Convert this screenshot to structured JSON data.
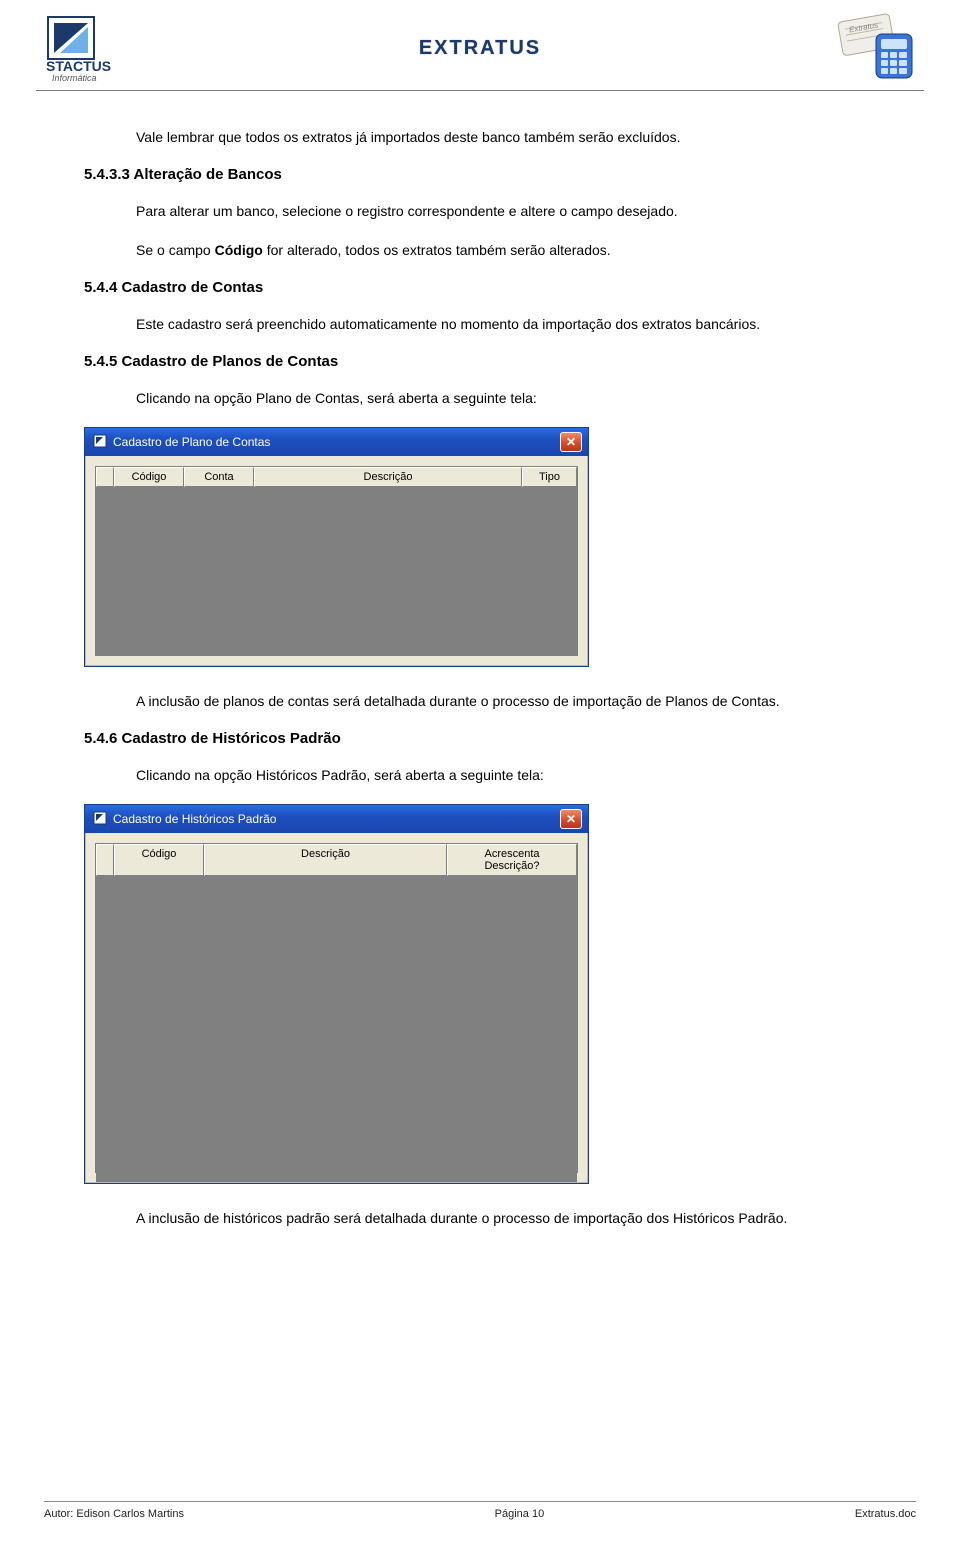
{
  "header": {
    "title": "EXTRATUS"
  },
  "paragraphs": {
    "intro": "Vale lembrar que todos os extratos já importados deste banco também serão excluídos.",
    "s533_title": "5.4.3.3  Alteração de Bancos",
    "s533_p1": "Para alterar um banco, selecione o registro correspondente e altere o campo desejado.",
    "s533_p2a": "Se o campo ",
    "s533_p2b": "Código",
    "s533_p2c": " for alterado, todos os extratos também serão alterados.",
    "s544_title": "5.4.4   Cadastro de Contas",
    "s544_p1": "Este cadastro será preenchido automaticamente no momento da importação dos extratos bancários.",
    "s545_title": "5.4.5   Cadastro de Planos de Contas",
    "s545_p1": "Clicando na opção Plano de Contas, será aberta a seguinte tela:",
    "s545_p2": "A inclusão de planos de contas será detalhada durante o processo de importação de Planos de Contas.",
    "s546_title": "5.4.6   Cadastro de Históricos Padrão",
    "s546_p1": "Clicando na opção Históricos Padrão, será aberta a seguinte tela:",
    "s546_p2": "A inclusão de históricos padrão será detalhada durante o processo de importação dos Históricos Padrão."
  },
  "window1": {
    "title": "Cadastro de Plano de Contas",
    "columns": [
      "Código",
      "Conta",
      "Descrição",
      "Tipo"
    ]
  },
  "window2": {
    "title": "Cadastro de Históricos Padrão",
    "columns": [
      "Código",
      "Descrição",
      "Acrescenta Descrição?"
    ]
  },
  "footer": {
    "author": "Autor: Edison Carlos Martins",
    "page": "Página 10",
    "file": "Extratus.doc"
  }
}
